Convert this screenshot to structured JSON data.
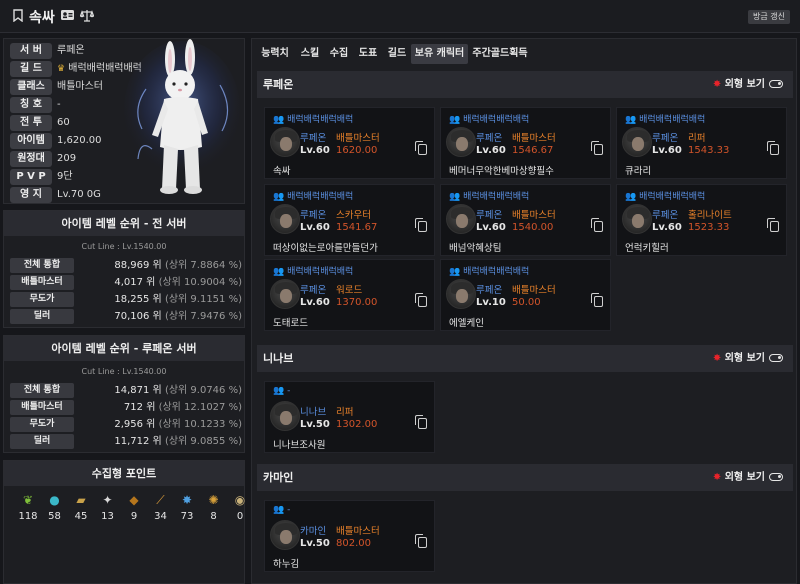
{
  "header": {
    "name": "속싸",
    "refresh_label": "방금 갱신",
    "icons": [
      "bookmark-icon",
      "id-card-icon",
      "scales-icon"
    ]
  },
  "profile": {
    "rows": [
      {
        "label": "서 버",
        "value": "루페온"
      },
      {
        "label": "길 드",
        "value": "배럭배럭배럭배럭",
        "icon": "crown-icon"
      },
      {
        "label": "클래스",
        "value": "배틀마스터"
      },
      {
        "label": "칭 호",
        "value": "-"
      },
      {
        "label": "전 투",
        "value": "60"
      },
      {
        "label": "아이템",
        "value": "1,620.00"
      },
      {
        "label": "원정대",
        "value": "209"
      },
      {
        "label": "P V P",
        "value": "9단"
      },
      {
        "label": "영 지",
        "value": "Lv.70 0G"
      }
    ]
  },
  "rank_all": {
    "title": "아이템 레벨 순위 - 전 서버",
    "cutline": "Cut Line : Lv.1540.00",
    "rows": [
      {
        "label": "전체 통합",
        "rank": "88,969 위",
        "pct": "(상위 7.8864 %)"
      },
      {
        "label": "배틀마스터",
        "rank": "4,017 위",
        "pct": "(상위 10.9004 %)"
      },
      {
        "label": "무도가",
        "rank": "18,255 위",
        "pct": "(상위 9.1151 %)"
      },
      {
        "label": "딜러",
        "rank": "70,106 위",
        "pct": "(상위 7.9476 %)"
      }
    ]
  },
  "rank_server": {
    "title": "아이템 레벨 순위 - 루페온 서버",
    "cutline": "Cut Line : Lv.1540.00",
    "rows": [
      {
        "label": "전체 통합",
        "rank": "14,871 위",
        "pct": "(상위 9.0746 %)"
      },
      {
        "label": "배틀마스터",
        "rank": "712 위",
        "pct": "(상위 12.1027 %)"
      },
      {
        "label": "무도가",
        "rank": "2,956 위",
        "pct": "(상위 10.1233 %)"
      },
      {
        "label": "딜러",
        "rank": "11,712 위",
        "pct": "(상위 9.0855 %)"
      }
    ]
  },
  "collection": {
    "title": "수집형 포인트",
    "items": [
      {
        "icon": "island-heart-icon",
        "value": "118",
        "color": "#7fbf3a",
        "glyph": "❦"
      },
      {
        "icon": "orb-icon",
        "value": "58",
        "color": "#3bb8c9",
        "glyph": "●"
      },
      {
        "icon": "artwork-icon",
        "value": "45",
        "color": "#c9a24a",
        "glyph": "▰"
      },
      {
        "icon": "mokoko-seed-icon",
        "value": "13",
        "color": "#d8d8d8",
        "glyph": "✦"
      },
      {
        "icon": "adventure-book-icon",
        "value": "9",
        "color": "#b5761d",
        "glyph": "◆"
      },
      {
        "icon": "voyage-icon",
        "value": "34",
        "color": "#d89a3a",
        "glyph": "⟋"
      },
      {
        "icon": "world-tree-leaf-icon",
        "value": "73",
        "color": "#4f9fe0",
        "glyph": "✸"
      },
      {
        "icon": "ignea-icon",
        "value": "8",
        "color": "#d8a13a",
        "glyph": "✺"
      },
      {
        "icon": "orpheus-star-icon",
        "value": "0",
        "color": "#c9b27a",
        "glyph": "◉"
      }
    ]
  },
  "tabs": [
    "능력치",
    "스킬",
    "수집",
    "도표",
    "길드",
    "보유 캐릭터",
    "주간골드획득"
  ],
  "active_tab": 5,
  "look_label": "외형 보기",
  "sections": [
    {
      "server": "루페온",
      "characters": [
        {
          "guild": "배럭배럭배럭배럭",
          "server": "루페온",
          "class": "배틀마스터",
          "level": "Lv.60",
          "ilvl": "1620.00",
          "name": "속싸"
        },
        {
          "guild": "배럭배럭배럭배럭",
          "server": "루페온",
          "class": "배틀마스터",
          "level": "Lv.60",
          "ilvl": "1546.67",
          "name": "베머너무악한베마상향필수"
        },
        {
          "guild": "배럭배럭배럭배럭",
          "server": "루페온",
          "class": "리퍼",
          "level": "Lv.60",
          "ilvl": "1543.33",
          "name": "큐라리"
        },
        {
          "guild": "배럭배럭배럭배럭",
          "server": "루페온",
          "class": "스카우터",
          "level": "Lv.60",
          "ilvl": "1541.67",
          "name": "떠상이없는로아를만들던가"
        },
        {
          "guild": "배럭배럭배럭배럭",
          "server": "루페온",
          "class": "배틀마스터",
          "level": "Lv.60",
          "ilvl": "1540.00",
          "name": "배넘악혜상팀"
        },
        {
          "guild": "배럭배럭배럭배럭",
          "server": "루페온",
          "class": "홀리나이트",
          "level": "Lv.60",
          "ilvl": "1523.33",
          "name": "언럭키힐러"
        },
        {
          "guild": "배럭배럭배럭배럭",
          "server": "루페온",
          "class": "워로드",
          "level": "Lv.60",
          "ilvl": "1370.00",
          "name": "도태로드"
        },
        {
          "guild": "배럭배럭배럭배럭",
          "server": "루페온",
          "class": "배틀마스터",
          "level": "Lv.10",
          "ilvl": "50.00",
          "name": "에엘케인"
        }
      ]
    },
    {
      "server": "니나브",
      "characters": [
        {
          "guild": "-",
          "server": "니나브",
          "class": "리퍼",
          "level": "Lv.50",
          "ilvl": "1302.00",
          "name": "니나브조사원"
        }
      ]
    },
    {
      "server": "카마인",
      "characters": [
        {
          "guild": "-",
          "server": "카마인",
          "class": "배틀마스터",
          "level": "Lv.50",
          "ilvl": "802.00",
          "name": "하누김"
        }
      ]
    }
  ]
}
